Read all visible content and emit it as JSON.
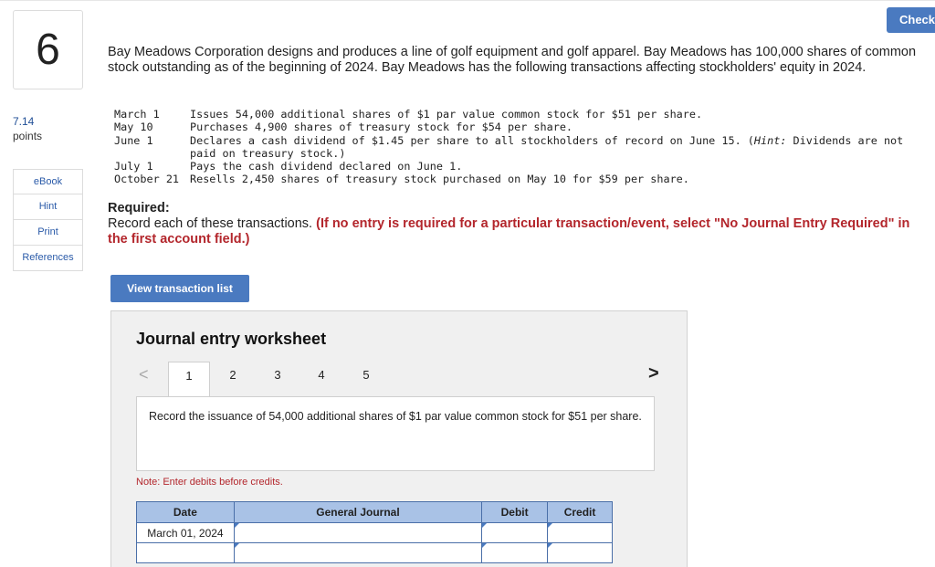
{
  "question": {
    "number": "6",
    "points_value": "7.14",
    "points_label": "points"
  },
  "side_links": [
    "eBook",
    "Hint",
    "Print",
    "References"
  ],
  "check_label": "Check",
  "intro": "Bay Meadows Corporation designs and produces a line of golf equipment and golf apparel. Bay Meadows has 100,000 shares of common stock outstanding as of the beginning of 2024. Bay Meadows has the following transactions affecting stockholders' equity in 2024.",
  "transactions": [
    {
      "date": "March 1",
      "desc": "Issues 54,000 additional shares of $1 par value common stock for $51 per share."
    },
    {
      "date": "May 10",
      "desc": "Purchases 4,900 shares of treasury stock for $54 per share."
    },
    {
      "date": "June 1",
      "desc_before": "Declares a cash dividend of $1.45 per share to all stockholders of record on June 15. (",
      "desc_hint": "Hint:",
      "desc_after": " Dividends are not paid on treasury stock.)"
    },
    {
      "date": "July 1",
      "desc": "Pays the cash dividend declared on June 1."
    },
    {
      "date": "October 21",
      "desc": "Resells 2,450 shares of treasury stock purchased on May 10 for $59 per share."
    }
  ],
  "required": {
    "heading": "Required:",
    "text": "Record each of these transactions. ",
    "hint": "(If no entry is required for a particular transaction/event, select \"No Journal Entry Required\" in the first account field.)"
  },
  "view_transaction_label": "View transaction list",
  "worksheet": {
    "title": "Journal entry worksheet",
    "pages": [
      "1",
      "2",
      "3",
      "4",
      "5"
    ],
    "prev_icon": "<",
    "next_icon": ">",
    "prompt": "Record the issuance of 54,000 additional shares of $1 par value common stock for $51 per share.",
    "note": "Note: Enter debits before credits.",
    "columns": [
      "Date",
      "General Journal",
      "Debit",
      "Credit"
    ],
    "rows": [
      {
        "date": "March 01, 2024",
        "account": "",
        "debit": "",
        "credit": ""
      },
      {
        "date": "",
        "account": "",
        "debit": "",
        "credit": ""
      }
    ]
  }
}
